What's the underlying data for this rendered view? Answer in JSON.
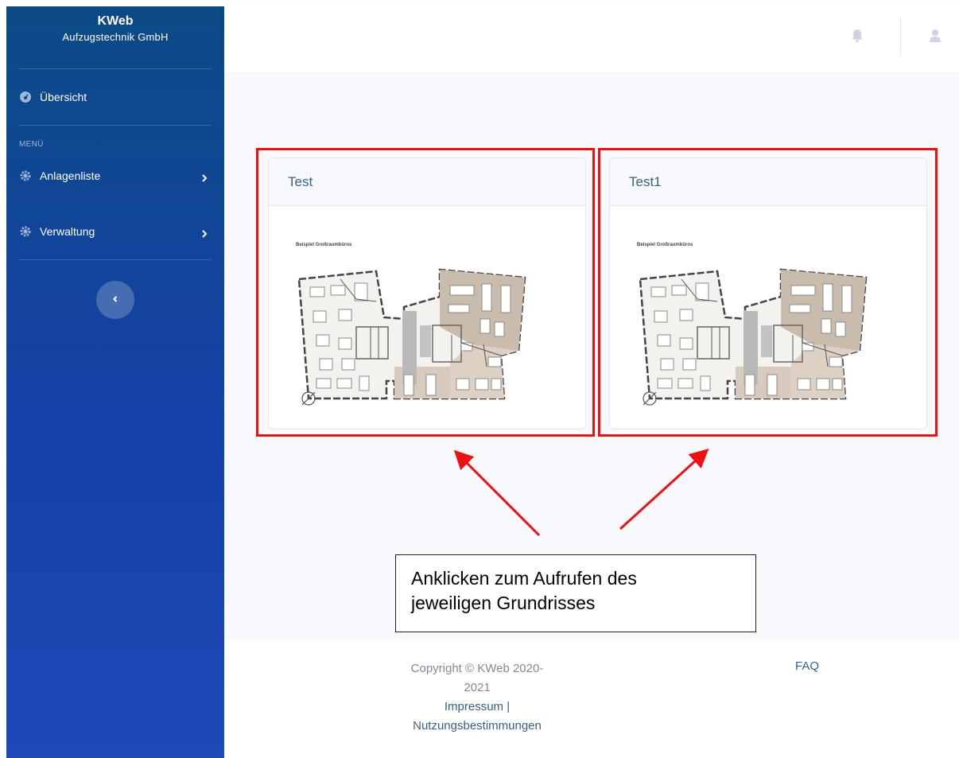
{
  "brand": {
    "name": "KWeb",
    "subtitle": "Aufzugstechnik GmbH"
  },
  "sidebar": {
    "overview_label": "Übersicht",
    "section_label": "MENÜ",
    "items": [
      {
        "label": "Anlagenliste"
      },
      {
        "label": "Verwaltung"
      }
    ]
  },
  "cards": [
    {
      "title": "Test",
      "plan_caption": "Beispiel Großraumbüros"
    },
    {
      "title": "Test1",
      "plan_caption": "Beispiel Großraumbüros"
    }
  ],
  "annotation": {
    "line1": "Anklicken zum Aufrufen des",
    "line2": "jeweiligen Grundrisses"
  },
  "footer": {
    "copyright_line1": "Copyright © KWeb 2020-",
    "copyright_line2": "2021",
    "impressum": "Impressum |",
    "terms": "Nutzungsbestimmungen",
    "faq": "FAQ"
  },
  "colors": {
    "sidebar_top": "#0c4a86",
    "sidebar_bottom": "#1f49b8",
    "highlight": "#ee1111",
    "link": "#3a5f86"
  }
}
